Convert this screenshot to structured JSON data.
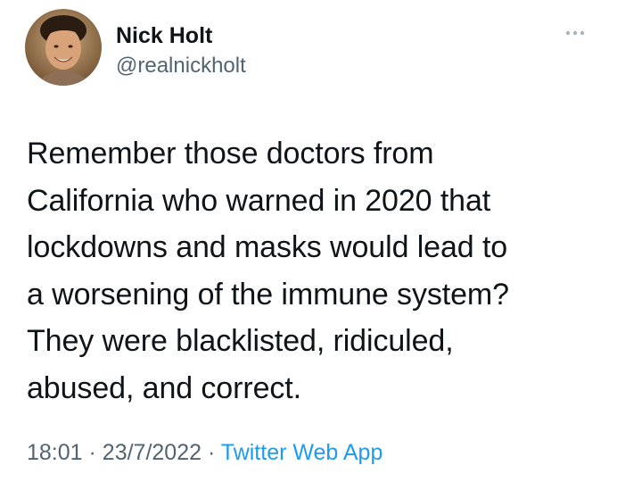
{
  "author": {
    "display_name": "Nick Holt",
    "handle": "@realnickholt"
  },
  "tweet": {
    "text": "Remember those doctors from\nCalifornia who warned in 2020 that\nlockdowns and masks would lead to\na worsening of the immune system?\nThey were blacklisted, ridiculed,\nabused, and correct."
  },
  "meta": {
    "time": "18:01",
    "separator": "·",
    "date": "23/7/2022",
    "source": "Twitter Web App"
  },
  "icons": {
    "more": "more-horizontal-icon",
    "avatar": "profile-photo"
  },
  "colors": {
    "text_primary": "#0f1419",
    "text_secondary": "#536471",
    "link": "#1d9bf0"
  }
}
